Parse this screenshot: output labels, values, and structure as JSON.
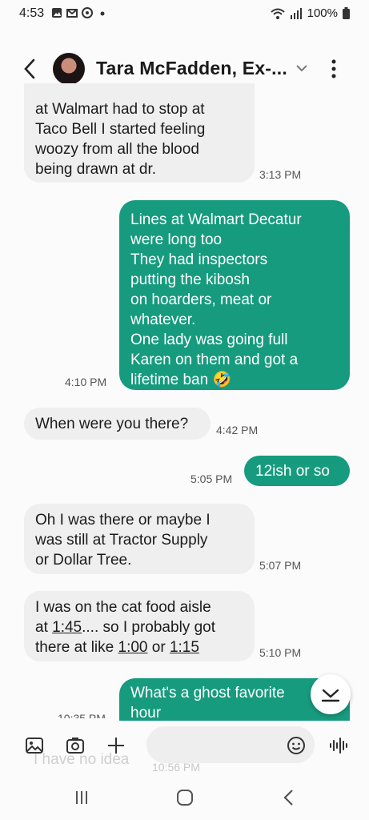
{
  "status_bar": {
    "time": "4:53",
    "battery": "100%"
  },
  "header": {
    "contact_name": "Tara McFadden, Ex-..."
  },
  "messages": [
    {
      "dir": "in",
      "lines": [
        "at Walmart had to stop at",
        "Taco Bell I started feeling",
        "woozy from all the blood",
        "being drawn at dr."
      ],
      "time": "3:13 PM"
    },
    {
      "dir": "out",
      "lines": [
        "Lines at Walmart Decatur",
        "were long too",
        "They had inspectors",
        "putting the kibosh",
        "on hoarders, meat or",
        "whatever.",
        "One lady was going full",
        "Karen on them and got a",
        "lifetime ban 🤣"
      ],
      "time": "4:10 PM"
    },
    {
      "dir": "in",
      "lines": [
        "When were you there?"
      ],
      "time": "4:42 PM"
    },
    {
      "dir": "out",
      "lines": [
        "12ish or so"
      ],
      "time": "5:05 PM"
    },
    {
      "dir": "in",
      "lines": [
        "Oh I was there or maybe I",
        "was still at Tractor Supply",
        "or Dollar Tree."
      ],
      "time": "5:07 PM"
    },
    {
      "dir": "in",
      "line1": "I was on the cat food aisle",
      "line2_pre": "at ",
      "line2_link": "1:45",
      "line2_post": ".... so I probably got",
      "line3_pre": "there at like ",
      "line3_link1": "1:00",
      "line3_mid": " or ",
      "line3_link2": "1:15",
      "time": "5:10 PM"
    },
    {
      "dir": "out",
      "lines": [
        "What's a ghost favorite",
        "hour"
      ],
      "time": "10:35 PM"
    }
  ],
  "ghost_message": {
    "text": "I have no idea",
    "time": "10:56 PM"
  },
  "colors": {
    "outgoing": "#169b7e",
    "incoming": "#efefef"
  },
  "icons": [
    "gallery-icon",
    "camera-icon",
    "plus-icon",
    "emoji-icon",
    "voice-icon",
    "scroll-down-icon"
  ]
}
